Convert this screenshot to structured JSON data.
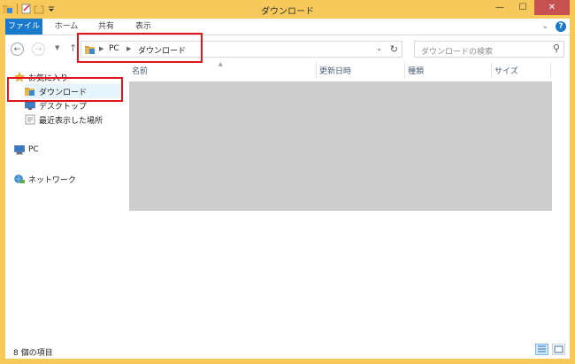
{
  "window": {
    "title": "ダウンロード"
  },
  "ribbon": {
    "tabs": [
      "ファイル",
      "ホーム",
      "共有",
      "表示"
    ]
  },
  "nav": {
    "breadcrumbs": [
      "PC",
      "ダウンロード"
    ],
    "search_placeholder": "ダウンロードの検索"
  },
  "sidebar": {
    "favorites_label": "お気に入り",
    "favorites": [
      "ダウンロード",
      "デスクトップ",
      "最近表示した場所"
    ],
    "pc_label": "PC",
    "network_label": "ネットワーク"
  },
  "columns": [
    "名前",
    "更新日時",
    "種類",
    "サイズ"
  ],
  "status": {
    "item_count": "8 個の項目"
  },
  "colors": {
    "frame": "#f6c95a",
    "file_tab": "#1979ca",
    "selection": "#e5f3fb",
    "annotation": "#e4141c",
    "redacted": "#cdcdcd"
  },
  "icons": {
    "folder": "folder-icon",
    "favorites": "star-icon",
    "pc": "computer-icon",
    "network": "network-icon"
  }
}
